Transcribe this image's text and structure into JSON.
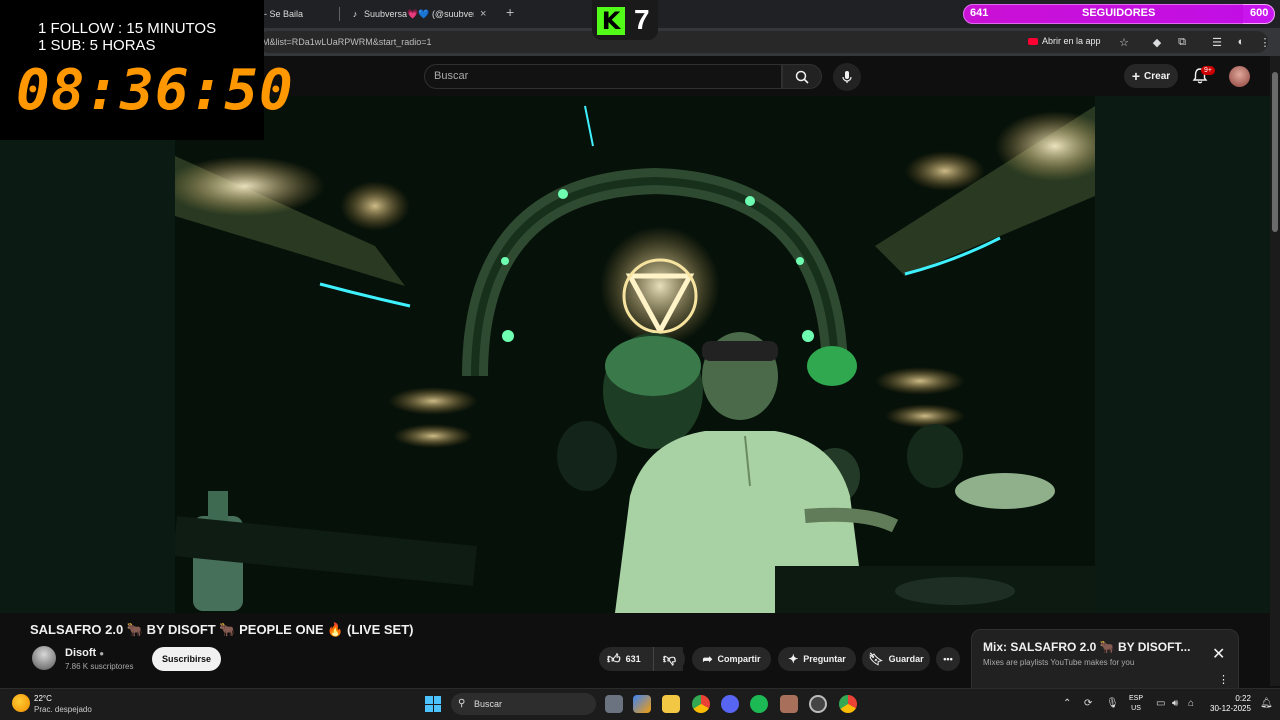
{
  "browser": {
    "tabs": [
      {
        "label": "ishi - Se Baila",
        "icon": "share-icon"
      },
      {
        "label": "Suubversa💗💙 (@suubversa_",
        "icon": "tiktok-icon"
      }
    ],
    "url": "M&list=RDa1wLUaRPWRM&start_radio=1",
    "open_in_app": "Abrir en la app"
  },
  "overlay": {
    "follow_rule": "1 FOLLOW : 15 MINUTOS",
    "sub_rule": "1 SUB: 5 HORAS",
    "countdown": "08:36:50",
    "kick_logo": "K",
    "kick_count": "7",
    "goal_current": "641",
    "goal_label": "SEGUIDORES",
    "goal_target": "600"
  },
  "youtube": {
    "search_placeholder": "Buscar",
    "create_label": "Crear",
    "notifications_badge": "9+",
    "video_title": "SALSAFRO 2.0 🐂 BY DISOFT 🐂 PEOPLE ONE 🔥 (LIVE SET)",
    "channel_name": "Disoft",
    "subscriber_count": "7.86 K suscriptores",
    "subscribe_label": "Suscribirse",
    "like_count": "631",
    "share_label": "Compartir",
    "ask_label": "Preguntar",
    "save_label": "Guardar",
    "mix_title": "Mix: SALSAFRO 2.0 🐂 BY DISOFT...",
    "mix_subtitle": "Mixes are playlists YouTube makes for you"
  },
  "taskbar": {
    "temperature": "22°C",
    "weather": "Prac. despejado",
    "search_label": "Buscar",
    "lang_1": "ESP",
    "lang_2": "US",
    "time": "0:22",
    "date": "30-12-2025"
  },
  "colors": {
    "countdown": "#ff9800",
    "kick_green": "#53fc18",
    "goal_magenta": "#c816f0",
    "youtube_red": "#ff0033"
  }
}
